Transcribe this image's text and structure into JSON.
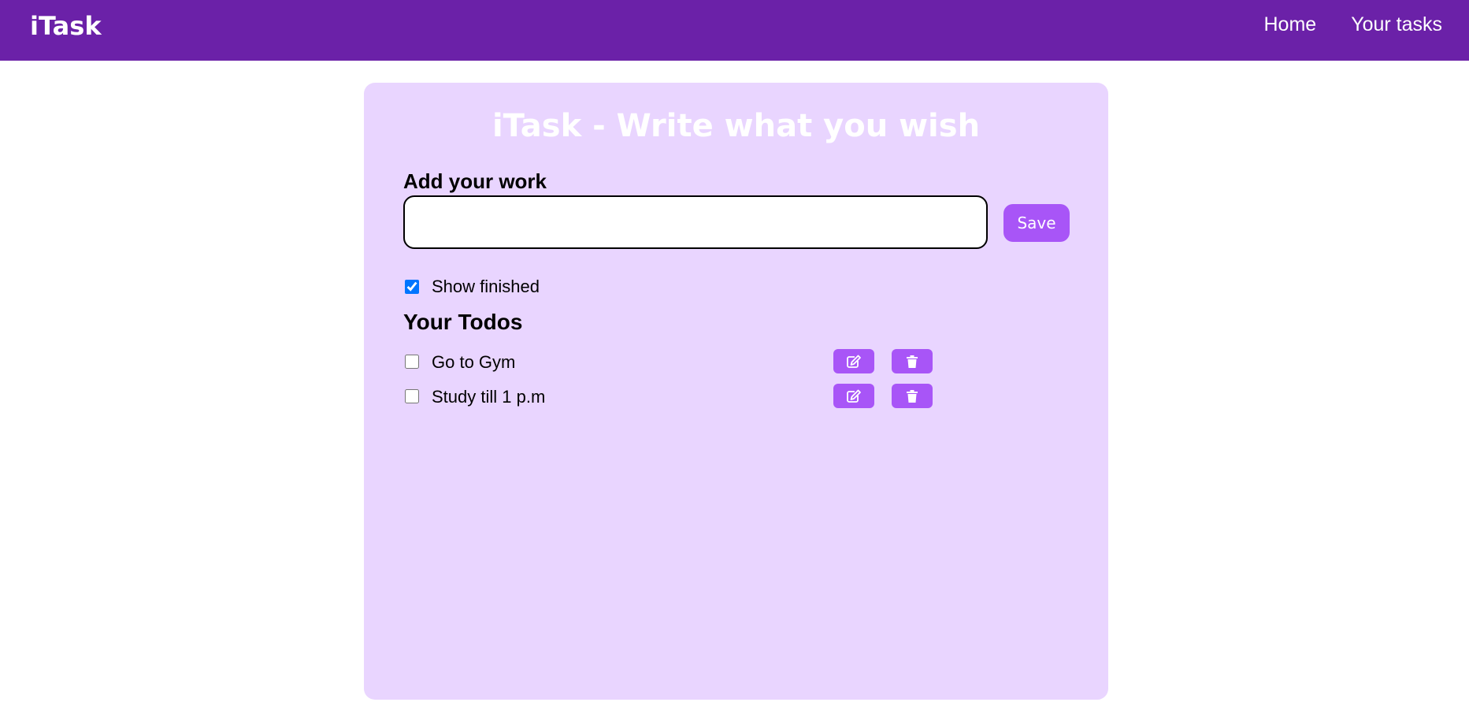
{
  "navbar": {
    "brand": "iTask",
    "links": [
      {
        "label": "Home"
      },
      {
        "label": "Your tasks"
      }
    ]
  },
  "card": {
    "title": "iTask - Write what you wish",
    "add_label": "Add your work",
    "input": {
      "value": "",
      "placeholder": ""
    },
    "save_label": "Save",
    "show_finished": {
      "label": "Show finished",
      "checked": true
    },
    "todos_heading": "Your Todos",
    "todos": [
      {
        "text": "Go to Gym",
        "done": false
      },
      {
        "text": "Study till 1 p.m",
        "done": false
      }
    ]
  },
  "colors": {
    "navbar": "#6b21a8",
    "card": "#e9d5ff",
    "button": "#a855f7"
  },
  "icons": {
    "edit": "edit-icon",
    "delete": "trash-icon"
  }
}
